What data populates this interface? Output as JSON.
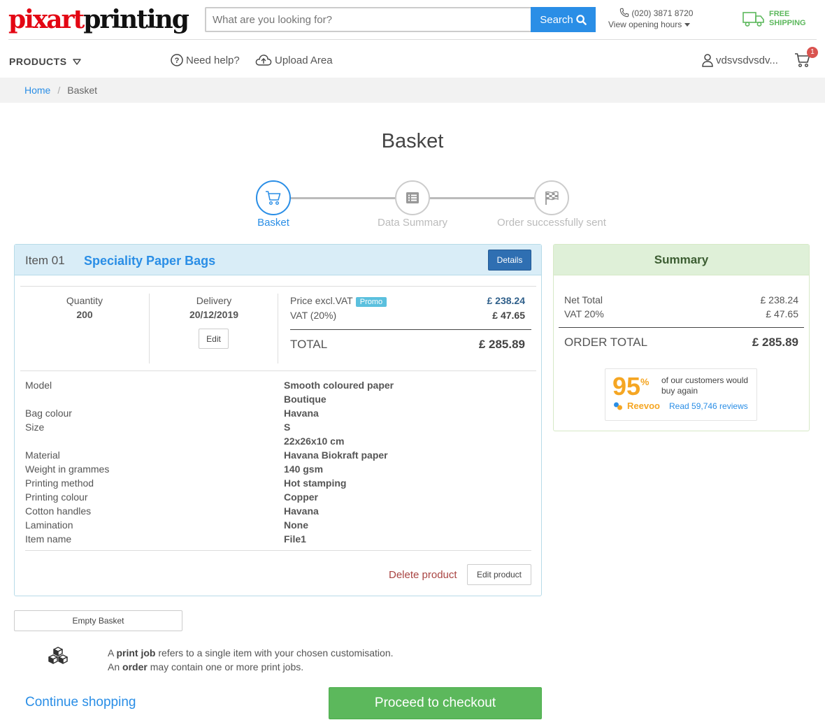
{
  "header": {
    "logo_part1": "pixart",
    "logo_part2": "printing",
    "search_placeholder": "What are you looking for?",
    "search_button": "Search",
    "phone": "(020) 3871 8720",
    "hours_label": "View opening hours",
    "shipping_line1": "FREE",
    "shipping_line2": "SHIPPING"
  },
  "nav": {
    "products": "PRODUCTS",
    "help": "Need help?",
    "upload": "Upload Area",
    "user": "vdsvsdvsdv...",
    "cart_count": "1"
  },
  "breadcrumb": {
    "home": "Home",
    "separator": "/",
    "current": "Basket"
  },
  "page_title": "Basket",
  "steps": [
    {
      "label": "Basket",
      "active": true,
      "icon": "cart-icon"
    },
    {
      "label": "Data Summary",
      "active": false,
      "icon": "list-icon"
    },
    {
      "label": "Order successfully sent",
      "active": false,
      "icon": "checkered-flag-icon"
    }
  ],
  "item": {
    "number": "Item 01",
    "title": "Speciality Paper Bags",
    "details_button": "Details",
    "quantity_label": "Quantity",
    "quantity_value": "200",
    "delivery_label": "Delivery",
    "delivery_value": "20/12/2019",
    "edit_button": "Edit",
    "price_label": "Price excl.VAT",
    "promo_badge": "Promo",
    "price_value": "£ 238.24",
    "vat_label": "VAT (20%)",
    "vat_value": "£ 47.65",
    "total_label": "TOTAL",
    "total_value": "£ 285.89",
    "specs": [
      {
        "label": "Model",
        "value": "Smooth coloured paper"
      },
      {
        "label": "",
        "value": "Boutique"
      },
      {
        "label": "Bag colour",
        "value": "Havana"
      },
      {
        "label": "Size",
        "value": "S"
      },
      {
        "label": "",
        "value": "22x26x10 cm"
      },
      {
        "label": "Material",
        "value": "Havana Biokraft paper"
      },
      {
        "label": "Weight in grammes",
        "value": "140 gsm"
      },
      {
        "label": "Printing method",
        "value": "Hot stamping"
      },
      {
        "label": "Printing colour",
        "value": "Copper"
      },
      {
        "label": "Cotton handles",
        "value": "Havana"
      },
      {
        "label": "Lamination",
        "value": "None"
      },
      {
        "label": "Item name",
        "value": "File1"
      }
    ],
    "delete_link": "Delete product",
    "edit_product_button": "Edit product"
  },
  "summary": {
    "title": "Summary",
    "net_label": "Net Total",
    "net_value": "£ 238.24",
    "vat_label": "VAT 20%",
    "vat_value": "£ 47.65",
    "order_total_label": "ORDER TOTAL",
    "order_total_value": "£ 285.89",
    "reevoo_percent": "95",
    "reevoo_percent_sign": "%",
    "reevoo_text": "of our customers would buy again",
    "reevoo_brand": "Reevoo",
    "reevoo_reviews": "Read 59,746 reviews"
  },
  "bottom": {
    "empty_basket": "Empty Basket",
    "info_1a": "A ",
    "info_1b": "print job",
    "info_1c": " refers to a single item with your chosen customisation.",
    "info_2a": "An ",
    "info_2b": "order",
    "info_2c": " may contain one or more print jobs.",
    "continue": "Continue shopping",
    "checkout": "Proceed to checkout"
  },
  "colors": {
    "accent": "#2a8ee6",
    "logo_red": "#e30613",
    "success": "#5cb85c",
    "danger": "#a94442",
    "reevoo_orange": "#f5a623"
  }
}
